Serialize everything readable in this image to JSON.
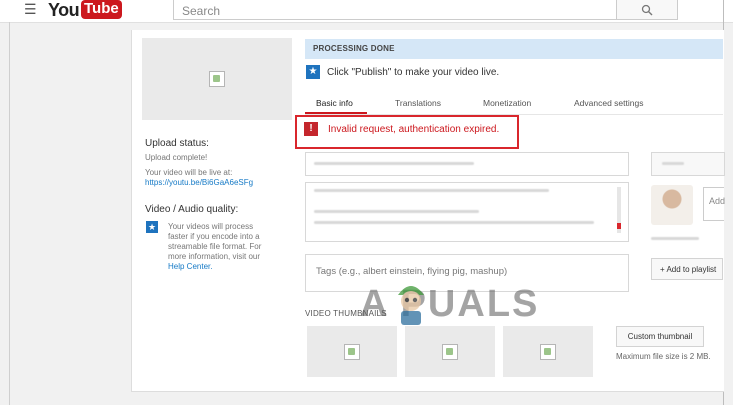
{
  "header": {
    "menu_icon": "hamburger-icon",
    "logo_you": "You",
    "logo_tube": "Tube",
    "logo_region": "IN",
    "search_placeholder": "Search",
    "search_icon": "search-icon"
  },
  "sidebar": {
    "upload_status_title": "Upload status:",
    "upload_complete": "Upload complete!",
    "live_at": "Your video will be live at:",
    "video_url": "https://youtu.be/Bi6GaA6eSFg",
    "quality_title": "Video / Audio quality:",
    "quality_text": [
      "Your videos will process",
      "faster if you encode into a",
      "streamable file format. For",
      "more information, visit our"
    ],
    "help_link": "Help Center."
  },
  "status": {
    "processing": "PROCESSING DONE",
    "publish_msg": "Click \"Publish\" to make your video live."
  },
  "tabs": [
    {
      "label": "Basic info",
      "active": true
    },
    {
      "label": "Translations",
      "active": false
    },
    {
      "label": "Monetization",
      "active": false
    },
    {
      "label": "Advanced settings",
      "active": false
    }
  ],
  "error": {
    "icon": "!",
    "message": "Invalid request, authentication expired."
  },
  "form": {
    "tags_placeholder": "Tags (e.g., albert einstein, flying pig, mashup)",
    "add_to_playlist": "+ Add to playlist",
    "share_placeholder": "Add"
  },
  "thumbnails": {
    "label": "VIDEO THUMBNAILS",
    "custom_button": "Custom thumbnail",
    "max_size": "Maximum file size is 2 MB."
  },
  "watermark": "A PUALS",
  "colors": {
    "brand_red": "#cc181e",
    "link_blue": "#167ac6",
    "processing_bg": "#d5e7f7"
  }
}
